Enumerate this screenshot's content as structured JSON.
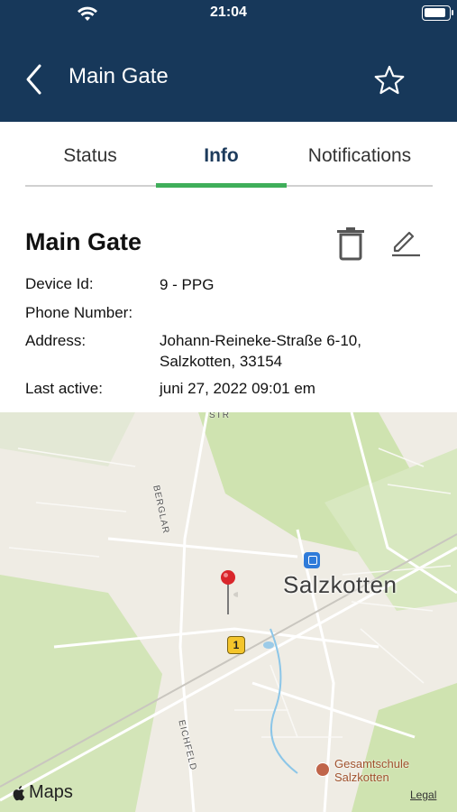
{
  "status_bar": {
    "time": "21:04",
    "icons": [
      "wifi-icon",
      "battery-icon"
    ]
  },
  "header": {
    "title": "Main Gate",
    "back_icon": "chevron-left-icon",
    "favorite_icon": "star-icon",
    "background": "#17385a"
  },
  "tabs": [
    {
      "label": "Status",
      "active": false
    },
    {
      "label": "Info",
      "active": true
    },
    {
      "label": "Notifications",
      "active": false
    }
  ],
  "tab_indicator_color": "#3fae5a",
  "device": {
    "name": "Main Gate",
    "actions": [
      "trash-icon",
      "edit-icon"
    ],
    "fields": [
      {
        "label": "Device Id:",
        "value": "9 - PPG"
      },
      {
        "label": "Phone Number:",
        "value": ""
      },
      {
        "label": "Address:",
        "value_lines": [
          "Johann-Reineke-Straße 6-10,",
          "Salzkotten, 33154"
        ]
      },
      {
        "label": "Last active:",
        "value": "juni 27, 2022 09:01 em"
      }
    ]
  },
  "map": {
    "city_label": "Salzkotten",
    "poi_lines": [
      "Gesamtschule",
      "Salzkotten"
    ],
    "road_labels": [
      "BERGLAR",
      "EICHFELD",
      "STR"
    ],
    "route_badge": "1",
    "attribution": "Maps",
    "legal_link": "Legal",
    "pin_color": "#d9262b"
  }
}
